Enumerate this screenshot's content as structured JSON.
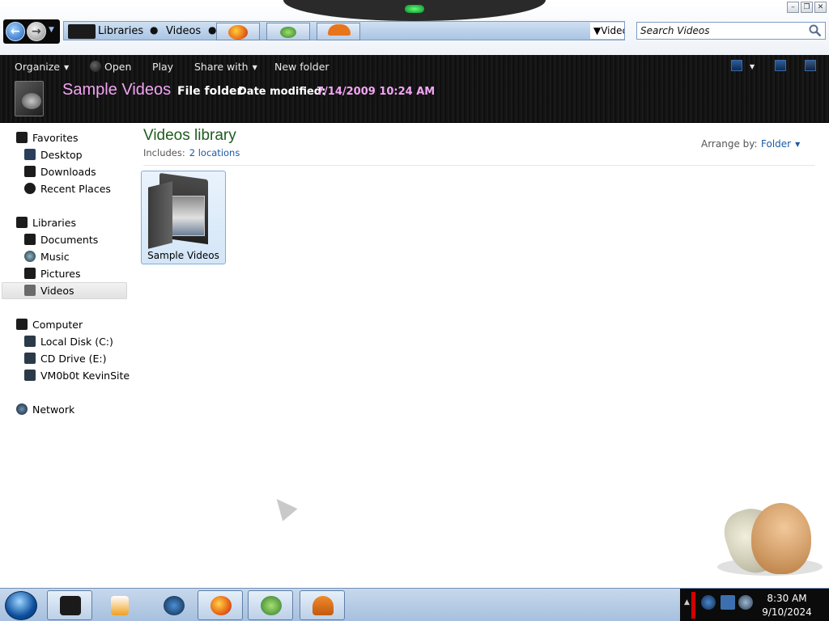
{
  "window": {
    "address": {
      "crumbs": [
        "Libraries",
        "Videos"
      ],
      "dropdown_text": "Videc"
    },
    "search": {
      "placeholder": "Search Videos"
    }
  },
  "commandbar": {
    "organize": "Organize",
    "open": "Open",
    "play": "Play",
    "share_with": "Share with",
    "new_folder": "New folder"
  },
  "details": {
    "name": "Sample Videos",
    "type": "File folder",
    "modified_label": "Date modified:",
    "modified_value": "7/14/2009 10:24 AM"
  },
  "navigation": {
    "favorites": {
      "label": "Favorites",
      "items": [
        "Desktop",
        "Downloads",
        "Recent Places"
      ]
    },
    "libraries": {
      "label": "Libraries",
      "items": [
        "Documents",
        "Music",
        "Pictures",
        "Videos"
      ],
      "selected": "Videos"
    },
    "computer": {
      "label": "Computer",
      "items": [
        "Local Disk (C:)",
        "CD Drive (E:)",
        "VM0b0t KevinSite"
      ]
    },
    "network": {
      "label": "Network"
    }
  },
  "content": {
    "title": "Videos library",
    "includes_label": "Includes:",
    "includes_link": "2 locations",
    "arrange_label": "Arrange by:",
    "arrange_value": "Folder",
    "items": [
      {
        "name": "Sample Videos",
        "selected": true
      }
    ]
  },
  "taskbar": {
    "time": "8:30 AM",
    "date": "9/10/2024"
  },
  "colors": {
    "detail_accent": "#f3a4f3",
    "library_title": "#1e5c1e",
    "link": "#1a5aa6",
    "tray_alert": "#d40000"
  },
  "icons": {
    "nav": [
      "back-arrow-icon",
      "forward-arrow-icon"
    ],
    "taskbar": [
      "explorer-icon",
      "media-player-icon",
      "globe-icon",
      "firefox-icon",
      "network-people-icon",
      "mushroom-house-icon"
    ]
  }
}
